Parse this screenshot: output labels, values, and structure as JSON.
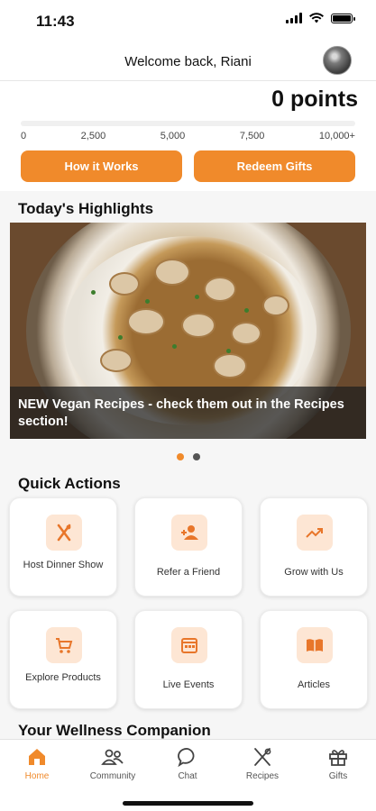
{
  "status": {
    "time": "11:43"
  },
  "header": {
    "welcome": "Welcome back, Riani"
  },
  "points": {
    "value_text": "0 points",
    "progress_fraction": 0,
    "ticks": [
      "0",
      "2,500",
      "5,000",
      "7,500",
      "10,000+"
    ],
    "how_it_works": "How it Works",
    "redeem": "Redeem Gifts"
  },
  "highlights": {
    "title": "Today's Highlights",
    "caption": "NEW Vegan Recipes - check them out in the Recipes section!",
    "dots": 2,
    "active_dot": 0
  },
  "quick_actions": {
    "title": "Quick Actions",
    "items": [
      {
        "label": "Host Dinner Show",
        "icon": "fork-knife-icon"
      },
      {
        "label": "Refer a Friend",
        "icon": "add-person-icon"
      },
      {
        "label": "Grow with Us",
        "icon": "trending-up-icon"
      },
      {
        "label": "Explore Products",
        "icon": "cart-icon"
      },
      {
        "label": "Live Events",
        "icon": "calendar-icon"
      },
      {
        "label": "Articles",
        "icon": "book-icon"
      }
    ]
  },
  "wellness": {
    "title": "Your Wellness Companion"
  },
  "nav": {
    "items": [
      {
        "label": "Home",
        "icon": "home-icon",
        "active": true
      },
      {
        "label": "Community",
        "icon": "community-icon",
        "active": false
      },
      {
        "label": "Chat",
        "icon": "chat-icon",
        "active": false
      },
      {
        "label": "Recipes",
        "icon": "recipes-icon",
        "active": false
      },
      {
        "label": "Gifts",
        "icon": "gift-icon",
        "active": false
      }
    ]
  },
  "colors": {
    "accent": "#f08a2b",
    "accent_light": "#fde6d4"
  }
}
